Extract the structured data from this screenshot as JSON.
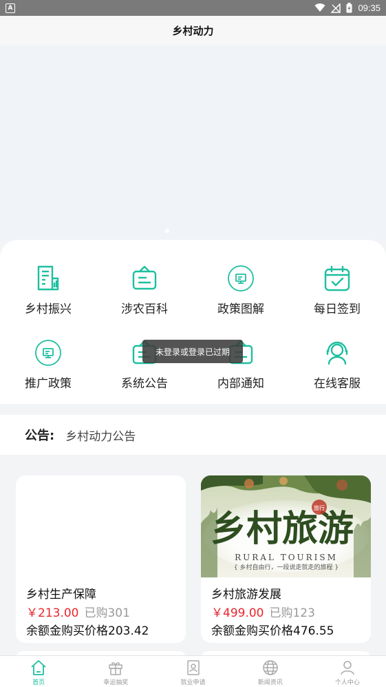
{
  "status_bar": {
    "badge": "A",
    "time": "09:35"
  },
  "header": {
    "title": "乡村动力"
  },
  "menu": [
    {
      "label": "乡村振兴",
      "icon": "report-icon"
    },
    {
      "label": "涉农百科",
      "icon": "bag-icon"
    },
    {
      "label": "政策图解",
      "icon": "monitor-icon"
    },
    {
      "label": "每日签到",
      "icon": "calendar-check-icon"
    },
    {
      "label": "推广政策",
      "icon": "monitor-icon"
    },
    {
      "label": "系统公告",
      "icon": "bag-icon"
    },
    {
      "label": "内部通知",
      "icon": "bag-icon"
    },
    {
      "label": "在线客服",
      "icon": "headset-icon"
    }
  ],
  "toast": "未登录或登录已过期",
  "notice": {
    "tag": "公告:",
    "text": "乡村动力公告"
  },
  "products": [
    {
      "title": "乡村生产保障",
      "price": "￥213.00",
      "sold": "已购301",
      "balance": "余额金购买价格203.42"
    },
    {
      "title": "乡村旅游发展",
      "price": "￥499.00",
      "sold": "已购123",
      "balance": "余额金购买价格476.55",
      "image_text": {
        "big": "乡村旅游",
        "seal": "旅行",
        "en": "RURAL TOURISM",
        "sub": "{ 乡村自由行，一段说走就走的旅程 }"
      }
    }
  ],
  "tabbar": [
    {
      "label": "首页",
      "icon": "home-icon",
      "active": true
    },
    {
      "label": "幸运抽奖",
      "icon": "gift-icon",
      "active": false
    },
    {
      "label": "就业申请",
      "icon": "id-card-icon",
      "active": false
    },
    {
      "label": "新闻资讯",
      "icon": "globe-icon",
      "active": false
    },
    {
      "label": "个人中心",
      "icon": "person-icon",
      "active": false
    }
  ],
  "colors": {
    "accent": "#1dbf9f",
    "price": "#e8262c",
    "status_bar": "#7a7a7a"
  }
}
